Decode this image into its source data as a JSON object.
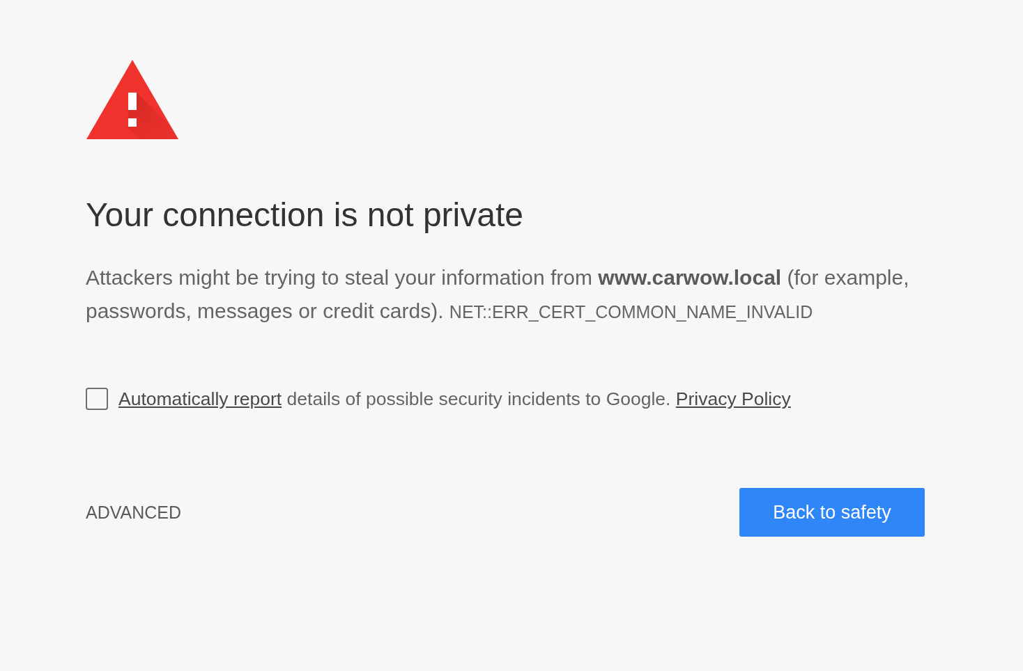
{
  "heading": "Your connection is not private",
  "message": "Attackers might be trying to steal your information from **www.carwow.local** (for example, passwords, messages or credit cards).",
  "error_code": "NET::ERR_CERT_COMMON_NAME_INVALID",
  "report_option": {
    "checked": false,
    "link": "Automatically report",
    "text": "details of possible security incidents to Google.",
    "policy_link": "Privacy Policy"
  },
  "advanced_button": "ADVANCED",
  "primary_button": "Back to safety"
}
